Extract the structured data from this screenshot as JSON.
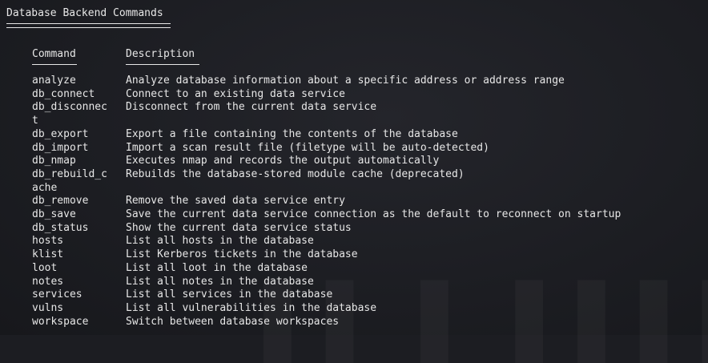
{
  "title": "Database Backend Commands",
  "columns": {
    "command": "Command",
    "description": "Description"
  },
  "commands": [
    {
      "command": "analyze",
      "description": "Analyze database information about a specific address or address range"
    },
    {
      "command": "db_connect",
      "description": "Connect to an existing data service"
    },
    {
      "command": "db_disconnec\nt",
      "description": "Disconnect from the current data service"
    },
    {
      "command": "db_export",
      "description": "Export a file containing the contents of the database"
    },
    {
      "command": "db_import",
      "description": "Import a scan result file (filetype will be auto-detected)"
    },
    {
      "command": "db_nmap",
      "description": "Executes nmap and records the output automatically"
    },
    {
      "command": "db_rebuild_c\nache",
      "description": "Rebuilds the database-stored module cache (deprecated)"
    },
    {
      "command": "db_remove",
      "description": "Remove the saved data service entry"
    },
    {
      "command": "db_save",
      "description": "Save the current data service connection as the default to reconnect on startup"
    },
    {
      "command": "db_status",
      "description": "Show the current data service status"
    },
    {
      "command": "hosts",
      "description": "List all hosts in the database"
    },
    {
      "command": "klist",
      "description": "List Kerberos tickets in the database"
    },
    {
      "command": "loot",
      "description": "List all loot in the database"
    },
    {
      "command": "notes",
      "description": "List all notes in the database"
    },
    {
      "command": "services",
      "description": "List all services in the database"
    },
    {
      "command": "vulns",
      "description": "List all vulnerabilities in the database"
    },
    {
      "command": "workspace",
      "description": "Switch between database workspaces"
    }
  ]
}
